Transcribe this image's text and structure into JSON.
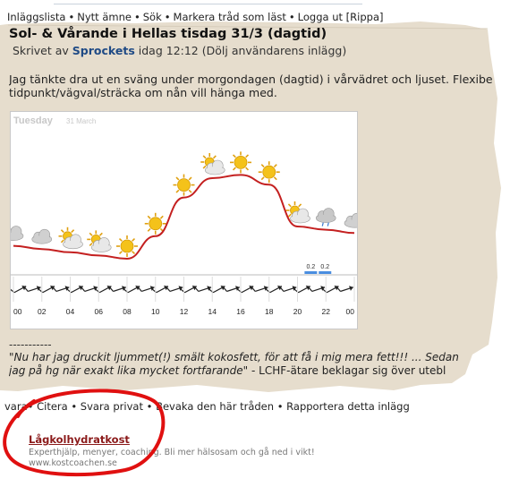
{
  "nav": {
    "items": [
      "Inläggslista",
      "Nytt ämne",
      "Sök",
      "Markera tråd som läst",
      "Logga ut [Rippa]"
    ],
    "separator": "•"
  },
  "post": {
    "title": "Sol- & Vårande i Hellas tisdag 31/3 (dagtid)",
    "written_prefix": "Skrivet av",
    "author": "Sprockets",
    "timestamp": "idag 12:12",
    "hide_link": "(Dölj användarens inlägg)",
    "body_line1": "Jag tänkte dra ut en sväng under morgondagen (dagtid) i vårvädret och ljuset. Flexibel",
    "body_line2": "tidpunkt/vägval/sträcka om nån vill hänga med."
  },
  "chart": {
    "day": "Tuesday",
    "date": "31 March",
    "rain_labels": [
      "0.2",
      "0.2"
    ],
    "hour_labels": [
      "00",
      "02",
      "04",
      "06",
      "08",
      "10",
      "12",
      "14",
      "16",
      "18",
      "20",
      "22",
      "00"
    ]
  },
  "chart_data": {
    "type": "line",
    "title": "Tuesday 31 March",
    "x": [
      "00",
      "02",
      "04",
      "06",
      "08",
      "10",
      "12",
      "14",
      "16",
      "18",
      "20",
      "22",
      "00"
    ],
    "series": [
      {
        "values": [
          6.5,
          6.0,
          5.5,
          5.0,
          4.5,
          8.0,
          14.0,
          17.0,
          17.5,
          16.0,
          9.5,
          9.0,
          8.5
        ]
      }
    ],
    "precipitation": [
      {
        "hour": "21",
        "value": 0.2
      },
      {
        "hour": "22",
        "value": 0.2
      }
    ],
    "weather_icons": [
      "cloud",
      "cloud",
      "sun-cloud",
      "sun-cloud",
      "sun",
      "sun",
      "sun",
      "sun-cloud",
      "sun",
      "sun",
      "sun-cloud",
      "cloud-rain",
      "cloud"
    ],
    "wind": "arrows-northeast",
    "grid": false
  },
  "signature": {
    "separator": "-----------",
    "quote": "\"Nu har jag druckit ljummet(!) smält kokosfett, för att få i mig mera fett!!! ... Sedan",
    "line2_quote": "jag på hg när exakt lika mycket fortfarande\"",
    "line2_rest": " - LCHF-ätare beklagar sig över utebl"
  },
  "actions": {
    "items": [
      "vara",
      "Citera",
      "Svara privat",
      "Bevaka den här tråden",
      "Rapportera detta inlägg"
    ],
    "separator": "•"
  },
  "ad": {
    "title": "Lågkolhydratkost",
    "description": "Experthjälp, menyer, coaching. Bli mer hälsosam och gå ned i vikt!",
    "url": "www.kostcoachen.se"
  },
  "colors": {
    "paper": "#e6ddcd",
    "author": "#1f4a85",
    "ad_title": "#8b1a1a",
    "circle": "#e01010",
    "temp_line": "#c42020"
  }
}
